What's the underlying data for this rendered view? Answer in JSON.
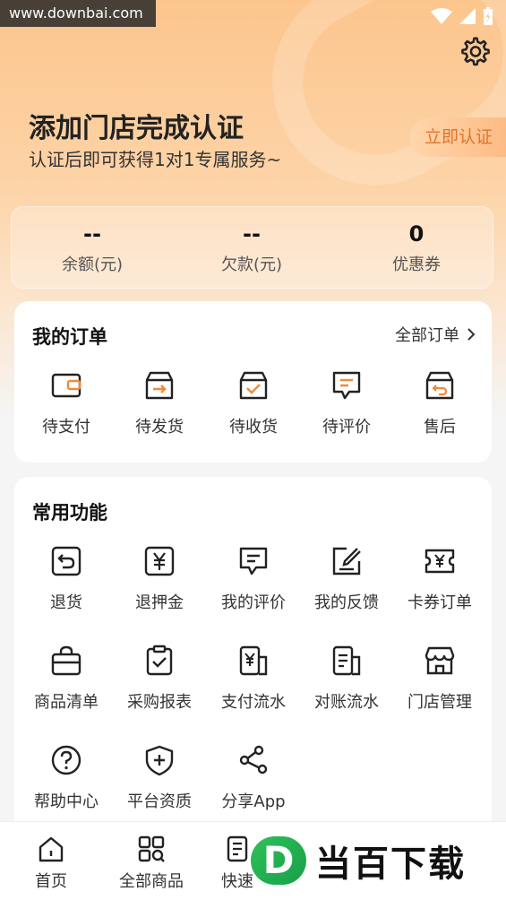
{
  "watermark_top": "www.downbai.com",
  "header": {
    "title": "添加门店完成认证",
    "subtitle": "认证后即可获得1对1专属服务~",
    "verify_button": "立即认证"
  },
  "stats": [
    {
      "value": "--",
      "label": "余额(元)"
    },
    {
      "value": "--",
      "label": "欠款(元)"
    },
    {
      "value": "0",
      "label": "优惠券"
    }
  ],
  "orders": {
    "title": "我的订单",
    "all_link": "全部订单",
    "items": [
      {
        "label": "待支付",
        "icon": "wallet-icon"
      },
      {
        "label": "待发货",
        "icon": "box-arrow-icon"
      },
      {
        "label": "待收货",
        "icon": "box-check-icon"
      },
      {
        "label": "待评价",
        "icon": "comment-icon"
      },
      {
        "label": "售后",
        "icon": "box-return-icon"
      }
    ]
  },
  "functions": {
    "title": "常用功能",
    "items": [
      {
        "label": "退货",
        "icon": "return-icon"
      },
      {
        "label": "退押金",
        "icon": "yen-deposit-icon"
      },
      {
        "label": "我的评价",
        "icon": "comment-icon"
      },
      {
        "label": "我的反馈",
        "icon": "edit-icon"
      },
      {
        "label": "卡券订单",
        "icon": "coupon-icon"
      },
      {
        "label": "商品清单",
        "icon": "bag-icon"
      },
      {
        "label": "采购报表",
        "icon": "clipboard-icon"
      },
      {
        "label": "支付流水",
        "icon": "payment-icon"
      },
      {
        "label": "对账流水",
        "icon": "statement-icon"
      },
      {
        "label": "门店管理",
        "icon": "store-icon"
      },
      {
        "label": "帮助中心",
        "icon": "help-icon"
      },
      {
        "label": "平台资质",
        "icon": "shield-plus-icon"
      },
      {
        "label": "分享App",
        "icon": "share-icon"
      }
    ]
  },
  "tabbar": [
    {
      "label": "首页",
      "icon": "home-icon"
    },
    {
      "label": "全部商品",
      "icon": "grid-search-icon"
    },
    {
      "label": "快速",
      "icon": "quick-order-icon"
    }
  ],
  "brand_watermark": {
    "logo_letter": "D",
    "text": "当百下载"
  },
  "colors": {
    "accent": "#e0752a",
    "header_gradient_start": "#fcc58d",
    "brand_green": "#2ec05a"
  }
}
